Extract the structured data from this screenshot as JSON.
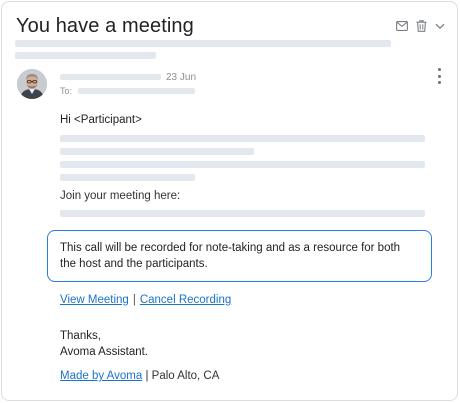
{
  "email": {
    "subject": "You have a meeting",
    "date": "23 Jun",
    "to_label": "To:",
    "greeting": "Hi <Participant>",
    "join_text": "Join your meeting here:",
    "notice": "This call will be recorded for note-taking and as a resource for both the host and the participants.",
    "links": {
      "view": "View Meeting",
      "separator": "|",
      "cancel": "Cancel Recording"
    },
    "signoff": {
      "thanks": "Thanks,",
      "name": "Avoma Assistant."
    },
    "footer": {
      "made_by": "Made by Avoma",
      "location": "| Palo Alto, CA"
    }
  },
  "icons": {
    "mail": "mail-icon",
    "trash": "trash-icon",
    "chevron": "chevron-down-icon",
    "more": "more-vertical-icon"
  },
  "colors": {
    "accent": "#2a7de1",
    "link": "#1a73c9",
    "placeholder": "#e3e8ee"
  }
}
